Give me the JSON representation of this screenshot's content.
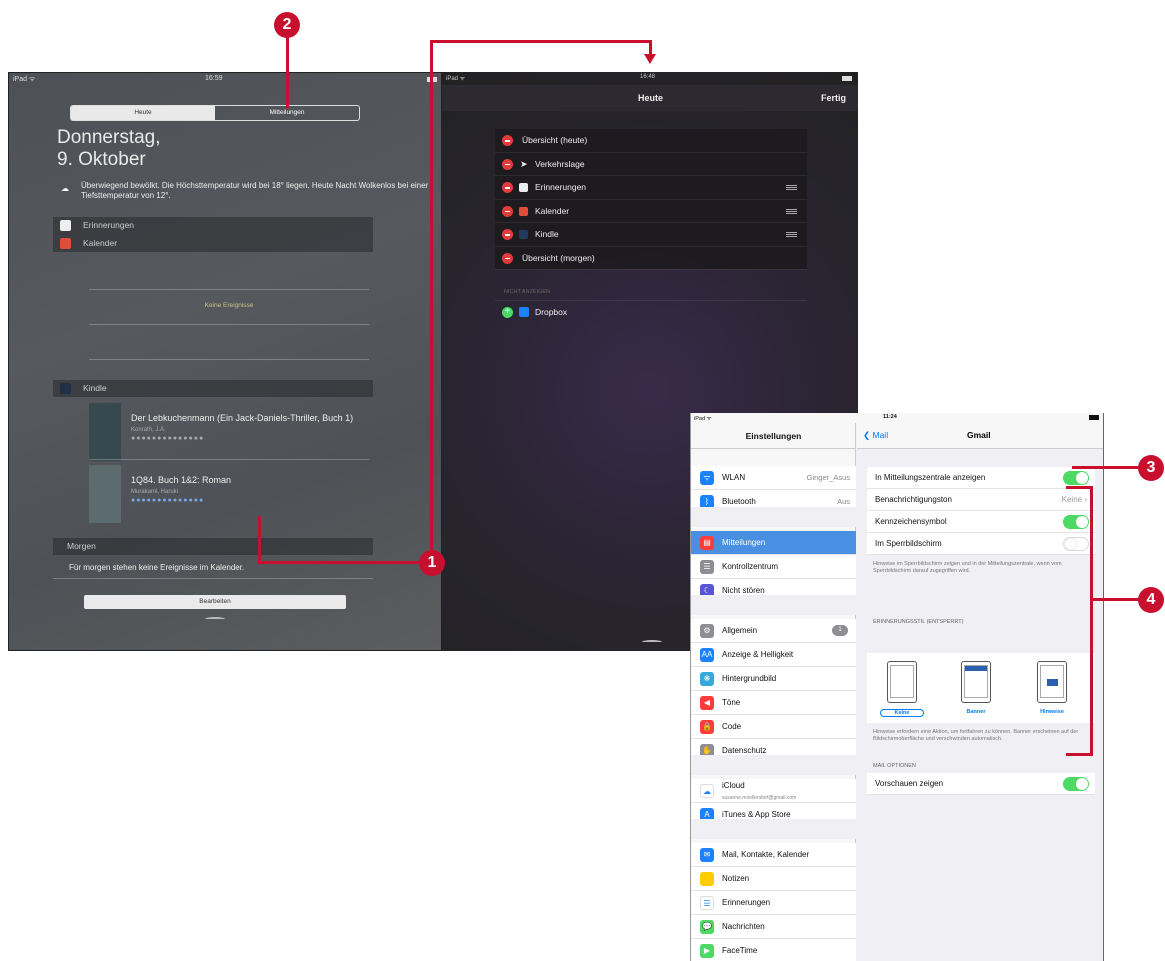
{
  "screen1": {
    "status_left": "iPad ᯤ",
    "status_time": "16:59",
    "tabs": [
      "Heute",
      "Mitteilungen"
    ],
    "date_line1": "Donnerstag,",
    "date_line2": "9. Oktober",
    "weather": "Überwiegend bewölkt. Die Höchsttemperatur wird bei 18° liegen. Heute Nacht Wolkenlos bei einer Tiefsttemperatur von 12°.",
    "sections": [
      "Erinnerungen",
      "Kalender"
    ],
    "no_events": "Keine Ereignisse",
    "kindle_label": "Kindle",
    "books": [
      {
        "title": "Der Lebkuchenmann (Ein Jack-Daniels-Thriller, Buch 1)",
        "author": "Konrath, J.A.",
        "dots": "●●●●●●●●●●●●●●",
        "progress": 0
      },
      {
        "title": "1Q84. Buch 1&2: Roman",
        "author": "Murakami, Haruki",
        "dots": "●●●●●●●●●●●●●●",
        "progress": 0.28
      }
    ],
    "morgen_label": "Morgen",
    "morgen_text": "Für morgen stehen keine Ereignisse im Kalender.",
    "edit_button": "Bearbeiten"
  },
  "screen2": {
    "status_left": "iPad ᯤ",
    "status_time": "16:48",
    "title": "Heute",
    "done": "Fertig",
    "items": [
      "Übersicht (heute)",
      "Verkehrslage",
      "Erinnerungen",
      "Kalender",
      "Kindle",
      "Übersicht (morgen)"
    ],
    "hidden_header": "NICHT ANZEIGEN",
    "hidden_items": [
      "Dropbox"
    ]
  },
  "screen3": {
    "status_left": "iPad ᯤ",
    "status_time": "11:24",
    "side_title": "Einstellungen",
    "side_items": [
      {
        "label": "WLAN",
        "value": "Ginger_Asus",
        "color": "#1a82fb",
        "icon": "ᯤ"
      },
      {
        "label": "Bluetooth",
        "value": "Aus",
        "color": "#1a82fb",
        "icon": "ᛒ"
      },
      {
        "label": "Mitteilungen",
        "value": "",
        "color": "#fc3d39",
        "icon": "▤"
      },
      {
        "label": "Kontrollzentrum",
        "value": "",
        "color": "#8e8e93",
        "icon": "☰"
      },
      {
        "label": "Nicht stören",
        "value": "",
        "color": "#5856d6",
        "icon": "☾"
      },
      {
        "label": "Allgemein",
        "value": "1",
        "color": "#8e8e93",
        "icon": "⚙"
      },
      {
        "label": "Anzeige & Helligkeit",
        "value": "",
        "color": "#1a82fb",
        "icon": "AA"
      },
      {
        "label": "Hintergrundbild",
        "value": "",
        "color": "#34aadc",
        "icon": "❋"
      },
      {
        "label": "Töne",
        "value": "",
        "color": "#fc3d39",
        "icon": "◀"
      },
      {
        "label": "Code",
        "value": "",
        "color": "#fc3d39",
        "icon": "🔒"
      },
      {
        "label": "Datenschutz",
        "value": "",
        "color": "#8e8e93",
        "icon": "✋"
      },
      {
        "label": "iCloud",
        "value": "",
        "color": "#ffffff",
        "icon": "☁"
      },
      {
        "label": "iTunes & App Store",
        "value": "",
        "color": "#1a82fb",
        "icon": "A"
      },
      {
        "label": "Mail, Kontakte, Kalender",
        "value": "",
        "color": "#1a82fb",
        "icon": "✉"
      },
      {
        "label": "Notizen",
        "value": "",
        "color": "#ffcc00",
        "icon": ""
      },
      {
        "label": "Erinnerungen",
        "value": "",
        "color": "#ffffff",
        "icon": "☰"
      },
      {
        "label": "Nachrichten",
        "value": "",
        "color": "#4cd964",
        "icon": "💬"
      },
      {
        "label": "FaceTime",
        "value": "",
        "color": "#4cd964",
        "icon": "▶"
      }
    ],
    "icloud_email": "susanne.moellendorf@gmail.com",
    "back_label": "Mail",
    "detail_title": "Gmail",
    "rows": [
      {
        "label": "In Mitteilungszentrale anzeigen",
        "toggle": true
      },
      {
        "label": "Benachrichtigungston",
        "value": "Keine"
      },
      {
        "label": "Kennzeichensymbol",
        "toggle": true
      },
      {
        "label": "Im Sperrbildschirm",
        "toggle": false
      }
    ],
    "hint1": "Hinweise im Sperrbildschirm zeigen und in der Mitteilungszentrale, wenn vom Sperrbildschirm darauf zugegriffen wird.",
    "style_header": "ERINNERUNGSSTIL (ENTSPERRT)",
    "styles": [
      "Keine",
      "Banner",
      "Hinweise"
    ],
    "hint2": "Hinweise erfordern eine Aktion, um fortfahren zu können. Banner erscheinen auf der Bildschirmoberfläche und verschwinden automatisch.",
    "mail_header": "MAIL OPTIONEN",
    "preview": "Vorschauen zeigen"
  },
  "callouts": [
    "1",
    "2",
    "3",
    "4"
  ],
  "accent": "#c8102e"
}
